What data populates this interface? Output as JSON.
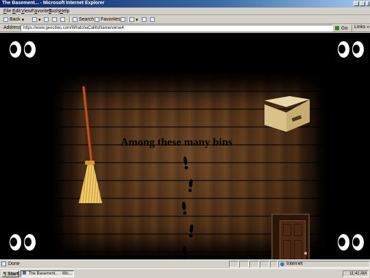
{
  "window": {
    "title": "The Basement... - Microsoft Internet Explorer"
  },
  "menu": [
    {
      "label": "File",
      "accel": "F"
    },
    {
      "label": "Edit",
      "accel": "E"
    },
    {
      "label": "View",
      "accel": "V"
    },
    {
      "label": "Favorites",
      "accel": "a"
    },
    {
      "label": "Tools",
      "accel": "T"
    },
    {
      "label": "Help",
      "accel": "H"
    }
  ],
  "toolbar": {
    "back": "Back",
    "search": "Search",
    "favorites": "Favorites"
  },
  "address": {
    "label": "Address",
    "url": "https://www.geocities.com/WhatchaCallItsName/verse4",
    "go": "Go",
    "links": "Links"
  },
  "page": {
    "headline": "Among these many bins"
  },
  "status": {
    "text": "Done",
    "zone": "Internet"
  },
  "taskbar": {
    "start": "Start",
    "task": "The Basement... - Mic...",
    "clock": "11:41 AM"
  },
  "icons": {
    "eyes": "eyes-icon",
    "broom": "broom-icon",
    "box": "cardboard-box-icon",
    "door": "door-icon",
    "footprint": "footprint-icon",
    "globe": "globe-icon"
  },
  "colors": {
    "titlebar": "#0a246a",
    "chrome": "#d4d0c8",
    "background": "#000000",
    "floor": "#4a2c14"
  }
}
